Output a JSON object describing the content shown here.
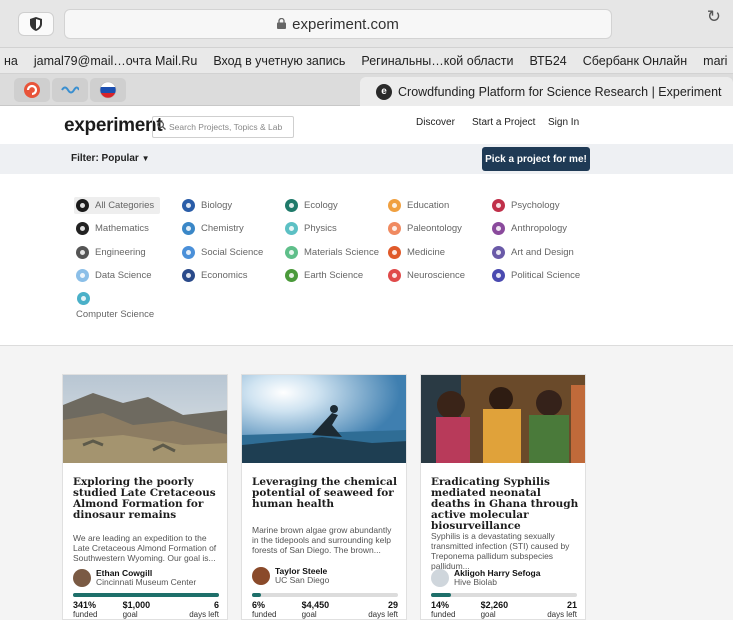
{
  "browser": {
    "url": "experiment.com",
    "bookmarks": [
      "на",
      "jamal79@mail…очта Mail.Ru",
      "Вход в учетную запись",
      "Регинальны…кой области",
      "ВТБ24",
      "Сбербанк Онлайн",
      "mari"
    ],
    "active_tab_title": "Crowdfunding Platform for Science Research | Experiment",
    "favicon_letter": "e"
  },
  "header": {
    "logo": "experiment",
    "search_placeholder": "Search Projects, Topics & Lab",
    "nav": [
      "Discover",
      "Start a Project",
      "Sign In"
    ]
  },
  "filterbar": {
    "filter_label": "Filter: Popular",
    "pick_button": "Pick a project for me!"
  },
  "categories": [
    {
      "label": "All Categories",
      "color": "#1a1a1a"
    },
    {
      "label": "Biology",
      "color": "#2a5da8"
    },
    {
      "label": "Ecology",
      "color": "#1f7a6a"
    },
    {
      "label": "Education",
      "color": "#f0a040"
    },
    {
      "label": "Psychology",
      "color": "#c0304a"
    },
    {
      "label": "Mathematics",
      "color": "#222222"
    },
    {
      "label": "Chemistry",
      "color": "#3a87c7"
    },
    {
      "label": "Physics",
      "color": "#5cc0c4"
    },
    {
      "label": "Paleontology",
      "color": "#f08a60"
    },
    {
      "label": "Anthropology",
      "color": "#8a4a9c"
    },
    {
      "label": "Engineering",
      "color": "#555555"
    },
    {
      "label": "Social Science",
      "color": "#4a90d9"
    },
    {
      "label": "Materials Science",
      "color": "#5fbf8a"
    },
    {
      "label": "Medicine",
      "color": "#e05a2a"
    },
    {
      "label": "Art and Design",
      "color": "#6a5aa8"
    },
    {
      "label": "Data Science",
      "color": "#8bbfe8"
    },
    {
      "label": "Economics",
      "color": "#2a4a8a"
    },
    {
      "label": "Earth Science",
      "color": "#4a9a3a"
    },
    {
      "label": "Neuroscience",
      "color": "#e04a4a"
    },
    {
      "label": "Political Science",
      "color": "#4a4ab0"
    },
    {
      "label": "Computer Science",
      "color": "#4ab0c8"
    }
  ],
  "projects": [
    {
      "title": "Exploring the poorly studied Late Cretaceous Almond Formation for dinosaur remains",
      "description": "We are leading an expedition to the Late Cretaceous Almond Formation of Southwestern Wyoming. Our goal is...",
      "author": "Ethan Cowgill",
      "org": "Cincinnati Museum Center",
      "funded_percent": 341,
      "funded": "341%",
      "funded_label": "funded",
      "goal": "$1,000",
      "goal_label": "goal",
      "days": "6",
      "days_label": "days left"
    },
    {
      "title": "Leveraging the chemical potential of seaweed for human health",
      "description": "Marine brown algae grow abundantly in the tidepools and surrounding kelp forests of San Diego. The brown...",
      "author": "Taylor Steele",
      "org": "UC San Diego",
      "funded_percent": 6,
      "funded": "6%",
      "funded_label": "funded",
      "goal": "$4,450",
      "goal_label": "goal",
      "days": "29",
      "days_label": "days left"
    },
    {
      "title": "Eradicating Syphilis mediated neonatal deaths in Ghana through active molecular biosurveillance",
      "description": "Syphilis is a devastating sexually transmitted infection (STI) caused by Treponema pallidum subspecies pallidum...",
      "author": "Akligoh Harry Sefoga",
      "org": "Hive Biolab",
      "funded_percent": 14,
      "funded": "14%",
      "funded_label": "funded",
      "goal": "$2,260",
      "goal_label": "goal",
      "days": "21",
      "days_label": "days left"
    }
  ]
}
